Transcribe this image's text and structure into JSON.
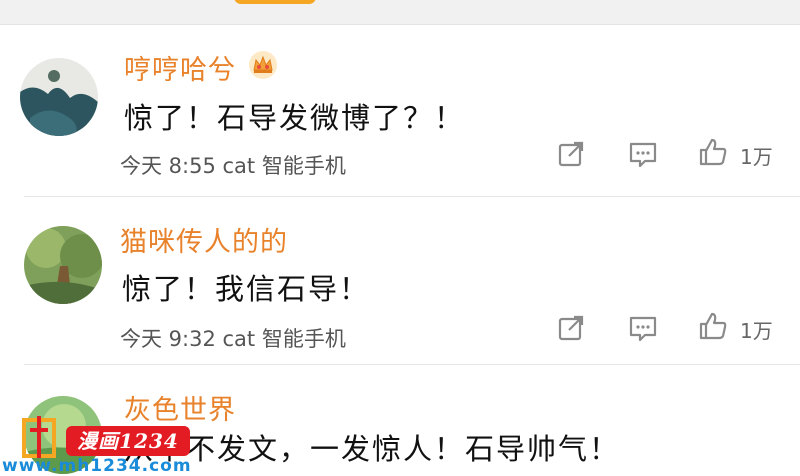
{
  "comments": [
    {
      "username": "哼哼哈兮",
      "has_badge": true,
      "text": "惊了！石导发微博了？！",
      "meta": "今天 8:55 cat 智能手机",
      "likes": "1万"
    },
    {
      "username": "猫咪传人的的",
      "has_badge": false,
      "text": "惊了！我信石导！",
      "meta": "今天 9:32 cat 智能手机",
      "likes": "1万"
    },
    {
      "username": "灰色世界",
      "has_badge": false,
      "text": "从不不发文，一发惊人！石导帅气！",
      "meta": "",
      "likes": ""
    }
  ],
  "icons": {
    "share": "share-icon",
    "reply": "comment-icon",
    "like": "thumbs-up-icon"
  },
  "colors": {
    "username": "#e8822b",
    "icon": "#8a8a8a"
  },
  "watermark": {
    "badge": "漫画1234",
    "url": "www.mh1234.com"
  }
}
